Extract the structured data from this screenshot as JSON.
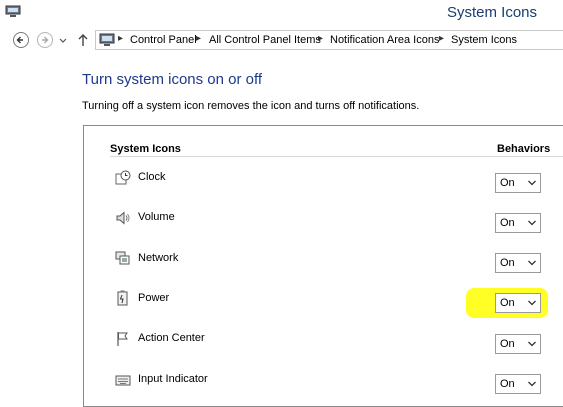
{
  "window": {
    "title": "System Icons"
  },
  "breadcrumb": [
    "Control Panel",
    "All Control Panel Items",
    "Notification Area Icons",
    "System Icons"
  ],
  "page": {
    "heading": "Turn system icons on or off",
    "description": "Turning off a system icon removes the icon and turns off notifications."
  },
  "table": {
    "col_name": "System Icons",
    "col_behavior": "Behaviors",
    "rows": [
      {
        "name": "Clock",
        "behavior": "On",
        "icon": "clock-icon"
      },
      {
        "name": "Volume",
        "behavior": "On",
        "icon": "speaker-icon"
      },
      {
        "name": "Network",
        "behavior": "On",
        "icon": "network-icon"
      },
      {
        "name": "Power",
        "behavior": "On",
        "icon": "power-icon",
        "highlighted": true
      },
      {
        "name": "Action Center",
        "behavior": "On",
        "icon": "flag-icon"
      },
      {
        "name": "Input Indicator",
        "behavior": "On",
        "icon": "keyboard-icon"
      }
    ]
  },
  "colors": {
    "heading": "#1e3a8c",
    "highlight": "#ffff00"
  }
}
